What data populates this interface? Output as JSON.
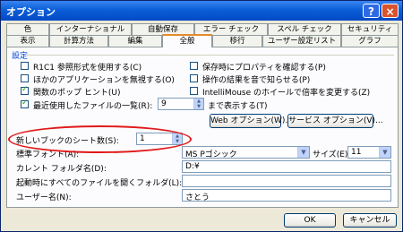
{
  "window": {
    "title": "オプション",
    "help_label": "?",
    "close_label": "×"
  },
  "tabs_top": [
    "色",
    "インターナショナル",
    "自動保存",
    "エラー チェック",
    "スペル チェック",
    "セキュリティ"
  ],
  "tabs_bottom": [
    "表示",
    "計算方法",
    "編集",
    "全般",
    "移行",
    "ユーザー設定リスト",
    "グラフ"
  ],
  "active_tab": "全般",
  "settings": {
    "group_label": "設定",
    "left_options": [
      {
        "label": "R1C1 参照形式を使用する(C)",
        "checked": false
      },
      {
        "label": "ほかのアプリケーションを無視する(O)",
        "checked": false
      },
      {
        "label": "関数のポップ ヒント(U)",
        "checked": true
      },
      {
        "label": "最近使用したファイルの一覧(R):",
        "checked": true
      }
    ],
    "right_options": [
      {
        "label": "保存時にプロパティを確認する(P)",
        "checked": false
      },
      {
        "label": "操作の結果を音で知らせる(P)",
        "checked": false
      },
      {
        "label": "IntelliMouse のホイールで倍率を変更する(Z)",
        "checked": false
      }
    ],
    "recent_files_count": "9",
    "recent_files_suffix": "まで表示する(T)",
    "web_options_button": "Web オプション(W)...",
    "service_options_button": "サービス オプション(V)...",
    "sheets_label": "新しいブックのシート数(S):",
    "sheets_value": "1",
    "font_label": "標準フォント(A):",
    "font_value": "MS Pゴシック",
    "size_label": "サイズ(E):",
    "size_value": "11",
    "folder_label": "カレント フォルダ名(D):",
    "folder_value": "D:¥",
    "startup_label": "起動時にすべてのファイルを開くフォルダ(L):",
    "startup_value": "",
    "user_label": "ユーザー名(N):",
    "user_value": "さとう"
  },
  "footer": {
    "ok_label": "OK",
    "cancel_label": "キャンセル"
  },
  "highlight": {
    "color": "#e11919"
  }
}
